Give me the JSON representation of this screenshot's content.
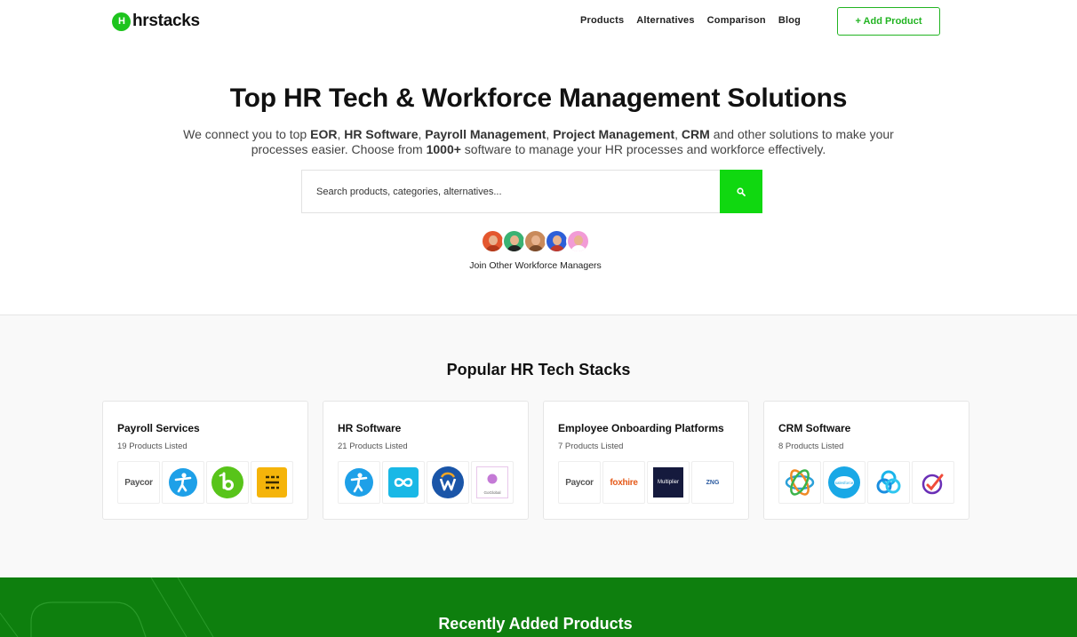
{
  "nav": {
    "logo_mark": "H",
    "logo_text": "hrstacks",
    "links": [
      {
        "label": "Products"
      },
      {
        "label": "Alternatives"
      },
      {
        "label": "Comparison"
      },
      {
        "label": "Blog"
      }
    ],
    "add_product_label": "+ Add Product"
  },
  "hero": {
    "title": "Top HR Tech & Workforce Management Solutions",
    "sub_1": "We connect you to top ",
    "sub_b1": "EOR",
    "sub_sep1": ", ",
    "sub_b2": "HR Software",
    "sub_sep2": ", ",
    "sub_b3": "Payroll Management",
    "sub_sep3": ", ",
    "sub_b4": "Project Management",
    "sub_sep4": ", ",
    "sub_b5": "CRM",
    "sub_2": " and other solutions to make your processes easier. Choose from ",
    "sub_b6": "1000+",
    "sub_3": " software to manage your HR processes and workforce effectively.",
    "search_placeholder": "Search products, categories, alternatives...",
    "join_text": "Join Other Workforce Managers"
  },
  "avatars": [
    {
      "bg": "#e4572e",
      "shirt": "#b33a1a"
    },
    {
      "bg": "#3bb273",
      "shirt": "#222222"
    },
    {
      "bg": "#c98a5b",
      "shirt": "#7a4a2a"
    },
    {
      "bg": "#2d5fd8",
      "shirt": "#c0392b"
    },
    {
      "bg": "#f29bd6",
      "shirt": "#ffffff"
    }
  ],
  "popular": {
    "title": "Popular HR Tech Stacks",
    "cards": [
      {
        "title": "Payroll Services",
        "count": "19 Products Listed",
        "logos": [
          "paycor-logo",
          "figure-logo",
          "bamboohr-logo",
          "yellow-stack-logo"
        ]
      },
      {
        "title": "HR Software",
        "count": "21 Products Listed",
        "logos": [
          "figure-logo",
          "infinity-logo",
          "workday-logo",
          "goglobal-logo"
        ]
      },
      {
        "title": "Employee Onboarding Platforms",
        "count": "7 Products Listed",
        "logos": [
          "paycor-logo",
          "foxhire-logo",
          "multiplier-logo",
          "zng-logo"
        ]
      },
      {
        "title": "CRM Software",
        "count": "8 Products Listed",
        "logos": [
          "orbit-logo",
          "salesforce-logo",
          "rings-logo",
          "chart-check-logo"
        ]
      }
    ],
    "logo_text": {
      "paycor": "Paycor",
      "foxhire": "foxhire",
      "multiplier": "Multiplier",
      "zng": "ZNG",
      "goglobal": "GoGlobal",
      "salesforce": "salesforce"
    }
  },
  "recent": {
    "title": "Recently Added Products"
  },
  "colors": {
    "brand_green": "#1ec41e",
    "search_green": "#10d810",
    "footer_green": "#0e7f0e"
  }
}
